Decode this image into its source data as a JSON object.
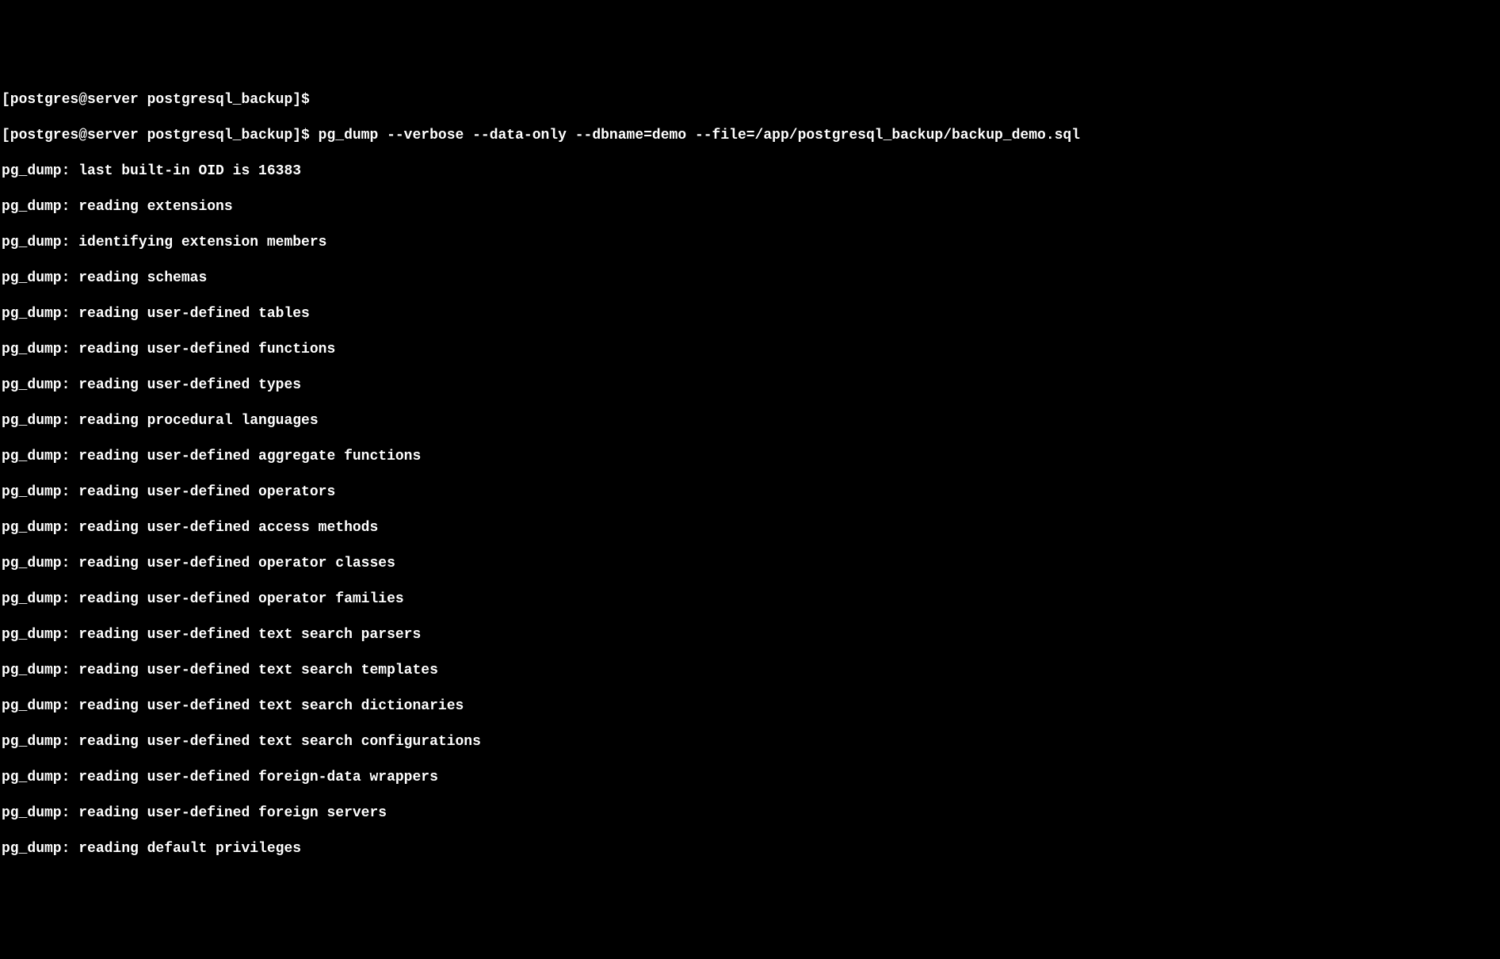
{
  "terminal": {
    "lines": [
      "[postgres@server postgresql_backup]$",
      "[postgres@server postgresql_backup]$ pg_dump --verbose --data-only --dbname=demo --file=/app/postgresql_backup/backup_demo.sql",
      "pg_dump: last built-in OID is 16383",
      "pg_dump: reading extensions",
      "pg_dump: identifying extension members",
      "pg_dump: reading schemas",
      "pg_dump: reading user-defined tables",
      "pg_dump: reading user-defined functions",
      "pg_dump: reading user-defined types",
      "pg_dump: reading procedural languages",
      "pg_dump: reading user-defined aggregate functions",
      "pg_dump: reading user-defined operators",
      "pg_dump: reading user-defined access methods",
      "pg_dump: reading user-defined operator classes",
      "pg_dump: reading user-defined operator families",
      "pg_dump: reading user-defined text search parsers",
      "pg_dump: reading user-defined text search templates",
      "pg_dump: reading user-defined text search dictionaries",
      "pg_dump: reading user-defined text search configurations",
      "pg_dump: reading user-defined foreign-data wrappers",
      "pg_dump: reading user-defined foreign servers",
      "pg_dump: reading default privileges"
    ]
  }
}
